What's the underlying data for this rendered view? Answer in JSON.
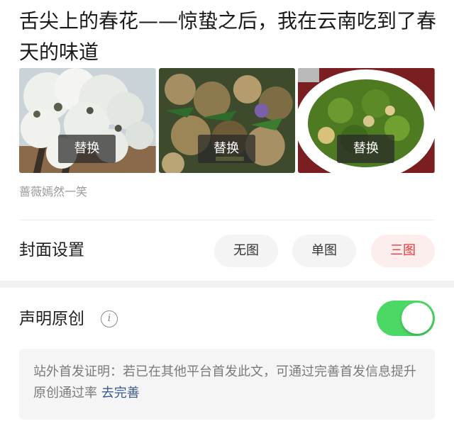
{
  "article": {
    "title": "舌尖上的春花——惊蛰之后，我在云南吃到了春天的味道",
    "author": "蔷薇嫣然一笑"
  },
  "thumbnails": [
    {
      "replace_label": "替换"
    },
    {
      "replace_label": "替换"
    },
    {
      "replace_label": "替换"
    }
  ],
  "cover_settings": {
    "label": "封面设置",
    "options": [
      "无图",
      "单图",
      "三图"
    ],
    "selected": "三图"
  },
  "originality": {
    "label": "声明原创",
    "info_icon": "i",
    "toggle_on": true,
    "notice_text": "站外首发证明：若已在其他平台首发此文，可通过完善首发信息提升原创通过率",
    "notice_link": "去完善"
  },
  "colors": {
    "accent_red": "#e6393b",
    "toggle_green": "#4cd864",
    "link_blue": "#3a5a8c"
  }
}
